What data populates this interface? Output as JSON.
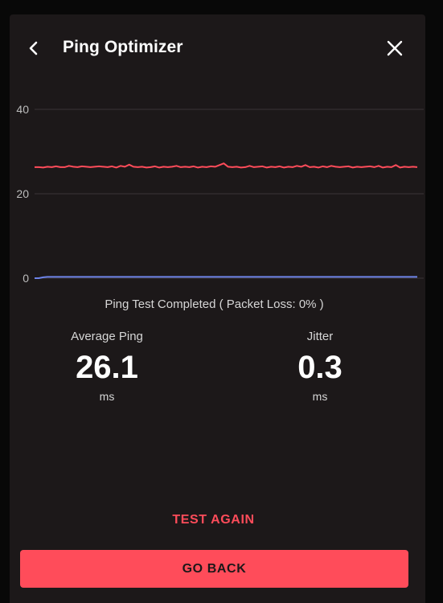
{
  "header": {
    "title": "Ping Optimizer",
    "back_icon": "chevron-left-icon",
    "close_icon": "close-icon"
  },
  "chart_data": {
    "type": "line",
    "title": "",
    "xlabel": "",
    "ylabel": "",
    "ylim": [
      0,
      40
    ],
    "yticks": [
      0,
      20,
      40
    ],
    "grid": true,
    "series": [
      {
        "color": "#ff4c5a",
        "values": [
          26.3,
          26.3,
          26.2,
          26.4,
          26.3,
          26.5,
          26.3,
          26.3,
          26.6,
          26.4,
          26.3,
          26.5,
          26.4,
          26.3,
          26.4,
          26.5,
          26.4,
          26.3,
          26.5,
          26.2,
          26.6,
          26.4,
          26.9,
          26.4,
          26.3,
          26.4,
          26.2,
          26.3,
          26.5,
          26.2,
          26.4,
          26.3,
          26.4,
          26.6,
          26.3,
          26.4,
          26.3,
          26.5,
          26.2,
          26.4,
          26.3,
          26.5,
          26.4,
          26.8,
          27.2,
          26.4,
          26.3,
          26.4,
          26.2,
          26.3,
          26.6,
          26.3,
          26.4,
          26.5,
          26.2,
          26.4,
          26.3,
          26.5,
          26.2,
          26.4,
          26.3,
          26.6,
          26.4,
          26.8,
          26.3,
          26.4,
          26.2,
          26.5,
          26.3,
          26.6,
          26.4,
          26.3,
          26.4,
          26.5,
          26.2,
          26.4,
          26.3,
          26.4,
          26.5,
          26.3,
          26.6,
          26.2,
          26.4,
          26.3,
          26.8,
          26.2,
          26.4,
          26.3,
          26.4,
          26.3
        ]
      },
      {
        "color": "#6d83e8",
        "values": [
          0.0,
          0.0,
          0.2,
          0.3,
          0.3,
          0.3,
          0.3,
          0.3,
          0.3,
          0.3,
          0.3,
          0.3,
          0.3,
          0.3,
          0.3,
          0.3,
          0.3,
          0.3,
          0.3,
          0.3,
          0.3,
          0.3,
          0.3,
          0.3,
          0.3,
          0.3,
          0.3,
          0.3,
          0.3,
          0.3,
          0.3,
          0.3,
          0.3,
          0.3,
          0.3,
          0.3,
          0.3,
          0.3,
          0.3,
          0.3,
          0.3,
          0.3,
          0.3,
          0.3,
          0.3,
          0.3,
          0.3,
          0.3,
          0.3,
          0.3,
          0.3,
          0.3,
          0.3,
          0.3,
          0.3,
          0.3,
          0.3,
          0.3,
          0.3,
          0.3,
          0.3,
          0.3,
          0.3,
          0.3,
          0.3,
          0.3,
          0.3,
          0.3,
          0.3,
          0.3,
          0.3,
          0.3,
          0.3,
          0.3,
          0.3,
          0.3,
          0.3,
          0.3,
          0.3,
          0.3,
          0.3,
          0.3,
          0.3,
          0.3,
          0.3,
          0.3,
          0.3,
          0.3,
          0.3,
          0.3
        ]
      }
    ]
  },
  "result": {
    "status_text": "Ping Test Completed ( Packet Loss: 0% )",
    "average_ping": {
      "label": "Average Ping",
      "value": "26.1",
      "unit": "ms"
    },
    "jitter": {
      "label": "Jitter",
      "value": "0.3",
      "unit": "ms"
    }
  },
  "actions": {
    "test_again_label": "TEST AGAIN",
    "go_back_label": "GO BACK"
  },
  "colors": {
    "accent": "#ff4c5a",
    "panel_background": "#1c1819",
    "jitter_line": "#6d83e8"
  }
}
